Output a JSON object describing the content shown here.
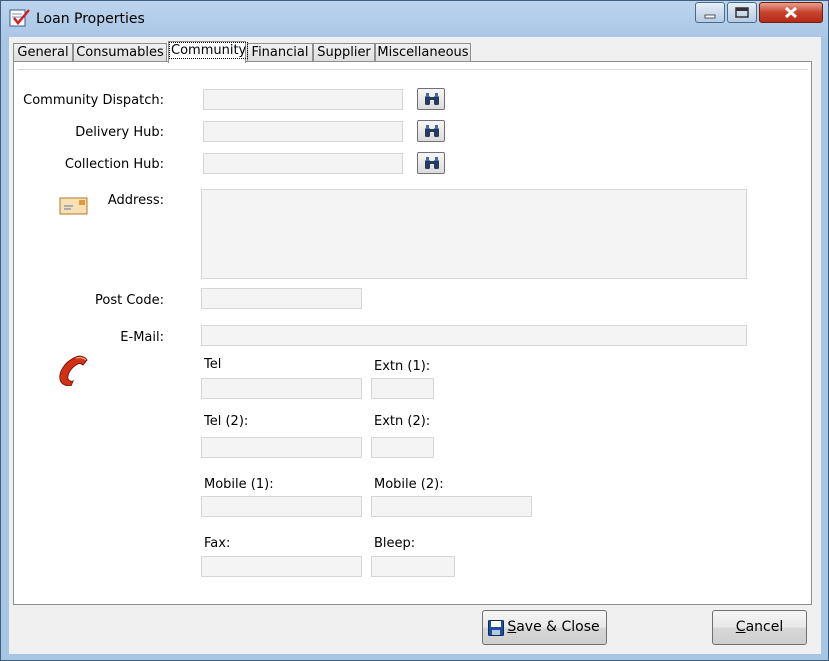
{
  "window": {
    "title": "Loan Properties"
  },
  "tabs": [
    {
      "label": "General",
      "active": false
    },
    {
      "label": "Consumables",
      "active": false
    },
    {
      "label": "Community",
      "active": true
    },
    {
      "label": "Financial",
      "active": false
    },
    {
      "label": "Supplier",
      "active": false
    },
    {
      "label": "Miscellaneous",
      "active": false
    }
  ],
  "form": {
    "community_dispatch": {
      "label": "Community Dispatch:",
      "value": ""
    },
    "delivery_hub": {
      "label": "Delivery Hub:",
      "value": ""
    },
    "collection_hub": {
      "label": "Collection Hub:",
      "value": ""
    },
    "address": {
      "label": "Address:",
      "value": ""
    },
    "post_code": {
      "label": "Post Code:",
      "value": ""
    },
    "email": {
      "label": "E-Mail:",
      "value": ""
    },
    "tel": {
      "label": "Tel",
      "value": ""
    },
    "extn1": {
      "label": "Extn (1):",
      "value": ""
    },
    "tel2": {
      "label": "Tel (2):",
      "value": ""
    },
    "extn2": {
      "label": "Extn (2):",
      "value": ""
    },
    "mobile1": {
      "label": "Mobile (1):",
      "value": ""
    },
    "mobile2": {
      "label": "Mobile (2):",
      "value": ""
    },
    "fax": {
      "label": "Fax:",
      "value": ""
    },
    "bleep": {
      "label": "Bleep:",
      "value": ""
    }
  },
  "icons": {
    "search": "binoculars-icon",
    "address": "envelope-icon",
    "phone": "telephone-icon",
    "save": "floppy-disk-icon"
  },
  "buttons": {
    "save_close": {
      "mnemonic": "S",
      "rest": "ave & Close"
    },
    "cancel": {
      "mnemonic": "C",
      "rest": "ancel"
    }
  }
}
